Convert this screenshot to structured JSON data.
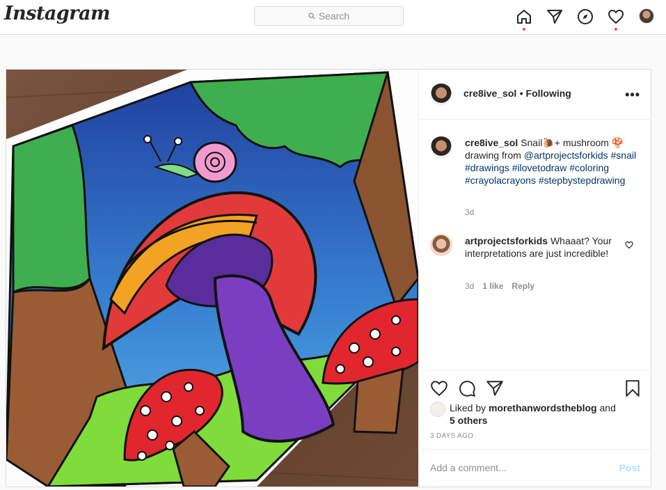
{
  "brand": {
    "logo_text": "Instagram"
  },
  "search": {
    "placeholder": "Search"
  },
  "nav": {
    "icons": [
      "home-icon",
      "direct-icon",
      "explore-icon",
      "activity-icon",
      "profile-avatar"
    ]
  },
  "post": {
    "author": {
      "username": "cre8ive_sol",
      "follow_status": "• Following"
    },
    "caption": {
      "username": "cre8ive_sol",
      "text": "Snail🐌+ mushroom 🍄 drawing from",
      "mention": "@artprojectsforkids",
      "hashtags": [
        "#snail",
        "#drawings",
        "#ilovetodraw",
        "#coloring",
        "#crayolacrayons",
        "#stepbystepdrawing"
      ],
      "time": "3d"
    },
    "comments": [
      {
        "username": "artprojectsforkids",
        "text": "Whaaat? Your interpretations are just incredible!",
        "time": "3d",
        "likes": "1 like",
        "reply_label": "Reply"
      }
    ],
    "liked_by": {
      "prefix": "Liked by",
      "user": "morethanwordstheblog",
      "and": "and",
      "others": "5 others"
    },
    "age": "3 DAYS AGO",
    "add_comment": {
      "placeholder": "Add a comment...",
      "post_label": "Post"
    },
    "photo_description": "colored drawing of a red mushroom with a pink snail on top"
  },
  "colors": {
    "link": "#00376b",
    "notification_dot": "#ed4956",
    "post_disabled": "#b2dffc"
  }
}
